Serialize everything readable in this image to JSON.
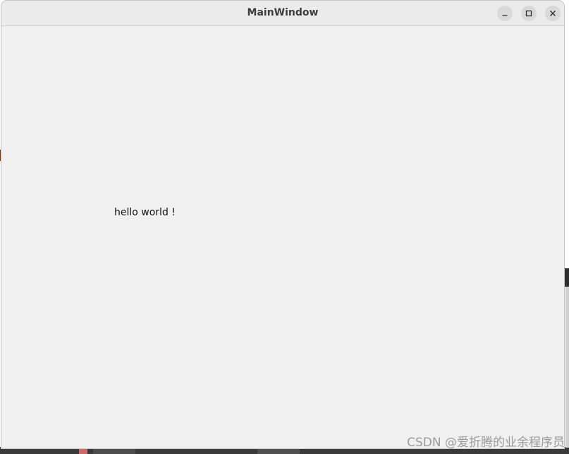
{
  "window": {
    "title": "MainWindow",
    "controls": {
      "minimize_icon": "minimize-icon",
      "maximize_icon": "maximize-icon",
      "close_icon": "close-icon"
    }
  },
  "content": {
    "label_text": "hello world !"
  },
  "watermark": {
    "text": "CSDN @爱折腾的业余程序员"
  },
  "colors": {
    "window_bg": "#f0f0f0",
    "titlebar_bg": "#ebebeb",
    "button_bg": "#d9d9d9",
    "title_text": "#3c3c3c"
  }
}
